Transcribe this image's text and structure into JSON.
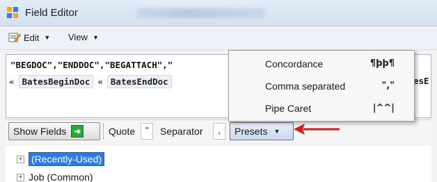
{
  "window": {
    "title": "Field Editor"
  },
  "toolbar": {
    "edit_label": "Edit",
    "view_label": "View"
  },
  "editor": {
    "code_line": "\"BEGDOC\",\"ENDDOC\",\"BEGATTACH\",\"",
    "token_sep": "«",
    "tokens": [
      "BatesBeginDoc",
      "BatesEndDoc"
    ],
    "token_right": "esE"
  },
  "fieldbar": {
    "show_fields_label": "Show Fields",
    "quote_label": "Quote",
    "quote_value": "\"",
    "separator_label": "Separator",
    "separator_value": ",",
    "presets_label": "Presets"
  },
  "presets_menu": {
    "items": [
      {
        "label": "Concordance",
        "glyph": "¶þþ¶"
      },
      {
        "label": "Comma separated",
        "glyph": "\",\""
      },
      {
        "label": "Pipe Caret",
        "glyph": "|^^|"
      }
    ]
  },
  "tree": {
    "items": [
      {
        "label": "(Recently-Used)",
        "selected": true
      },
      {
        "label": "Job (Common)",
        "selected": false
      }
    ]
  },
  "colors": {
    "selection": "#2f7be6",
    "annotation_arrow": "#d21d1d",
    "show_fields_icon": "#27a83a"
  }
}
